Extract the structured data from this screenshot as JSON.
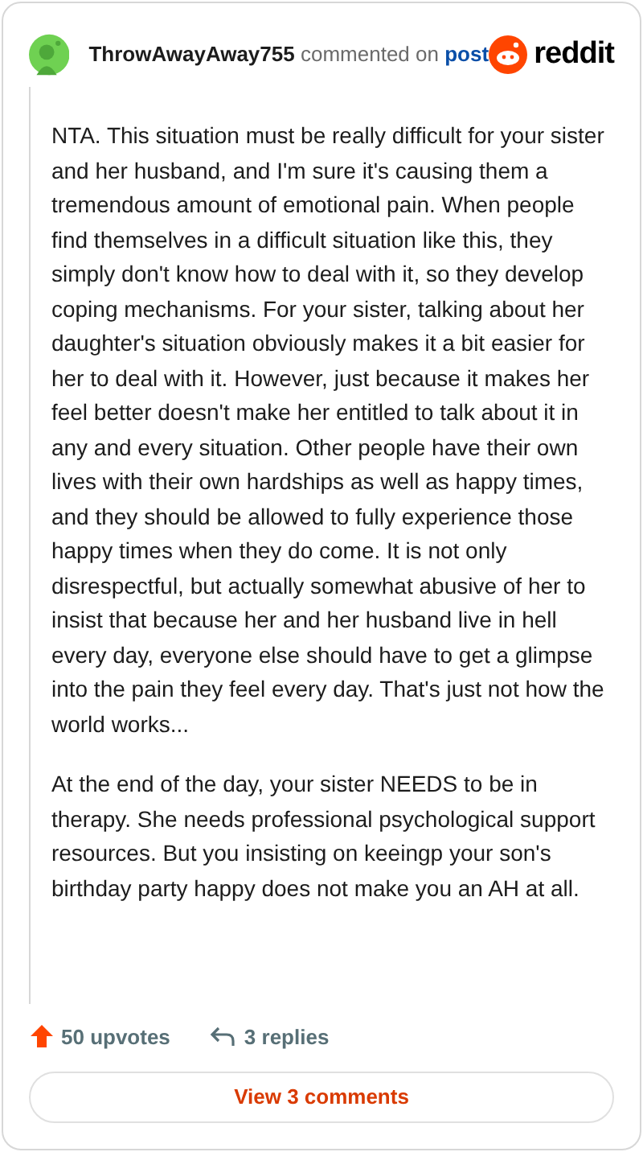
{
  "comment": {
    "username": "ThrowAwayAway755",
    "action": "commented on",
    "link": "post",
    "brand": "reddit",
    "paragraphs": [
      "NTA. This situation must be really difficult for your sister and her husband, and I'm sure it's causing them a tremendous amount of emotional pain. When people find themselves in a difficult situation like this, they simply don't know how to deal with it, so they develop coping mechanisms. For your sister, talking about her daughter's situation obviously makes it a bit easier for her to deal with it. However, just because it makes her feel better doesn't make her entitled to talk about it in any and every situation. Other people have their own lives with their own hardships as well as happy times, and they should be allowed to fully experience those happy times when they do come. It is not only disrespectful, but actually somewhat abusive of her to insist that because her and her husband live in hell every day, everyone else should have to get a glimpse into the pain they feel every day. That's just not how the world works...",
      "At the end of the day, your sister NEEDS to be in therapy. She needs professional psychological support resources. But you insisting on keeingp your son's birthday party happy does not make you an AH at all."
    ],
    "upvotes": "50 upvotes",
    "replies": "3 replies",
    "view_button": "View 3 comments"
  }
}
